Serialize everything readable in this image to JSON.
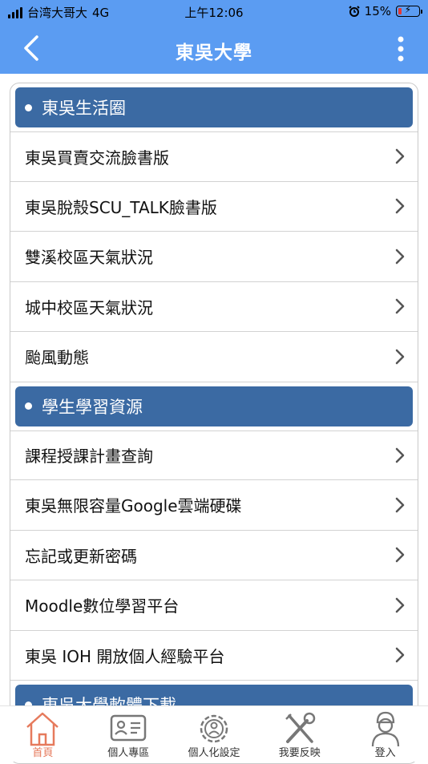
{
  "status_bar": {
    "carrier": "台湾大哥大",
    "network": "4G",
    "time": "上午12:06",
    "battery": "15%",
    "battery_level": 0.15
  },
  "nav": {
    "title": "東吳大學"
  },
  "sections": [
    {
      "title": "東吳生活圈",
      "items": [
        {
          "label": "東吳買賣交流臉書版"
        },
        {
          "label": "東吳脫殼SCU_TALK臉書版"
        },
        {
          "label": "雙溪校區天氣狀況"
        },
        {
          "label": "城中校區天氣狀況"
        },
        {
          "label": "颱風動態"
        }
      ]
    },
    {
      "title": "學生學習資源",
      "items": [
        {
          "label": "課程授課計畫查詢"
        },
        {
          "label": "東吳無限容量Google雲端硬碟"
        },
        {
          "label": "忘記或更新密碼"
        },
        {
          "label": "Moodle數位學習平台"
        },
        {
          "label": "東吳 IOH 開放個人經驗平台"
        }
      ]
    },
    {
      "title": "東吳大學軟體下載",
      "items": []
    }
  ],
  "tabs": [
    {
      "label": "首頁",
      "icon": "home-icon",
      "active": true
    },
    {
      "label": "個人專區",
      "icon": "id-card-icon",
      "active": false
    },
    {
      "label": "個人化設定",
      "icon": "gear-person-icon",
      "active": false
    },
    {
      "label": "我要反映",
      "icon": "tools-icon",
      "active": false
    },
    {
      "label": "登入",
      "icon": "user-icon",
      "active": false
    }
  ],
  "colors": {
    "header_bg": "#5b9cf2",
    "section_bg": "#3b6aa3",
    "active_tab": "#e67a5c",
    "battery_low": "#e53935"
  }
}
